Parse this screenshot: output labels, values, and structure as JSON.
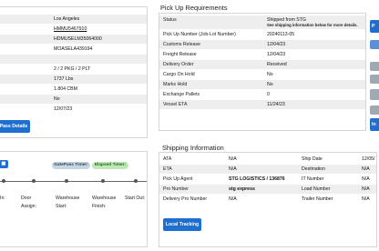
{
  "left_panel": {
    "values": [
      "Los Angeles",
      "HMMU5467910",
      "HDMUSELM35064000",
      "MOASELA439194",
      "",
      "2 / 2 PKG / 2 PLT",
      "1737 Lbs",
      "1.804 CBM",
      "No",
      "12/07/23"
    ],
    "gatepass_button": "Pass Details"
  },
  "timers": {
    "gatepass_label": "GatePass Timer:",
    "elapsed_label": "Elapsed Timer:",
    "steps": [
      {
        "line1": "In:",
        "line2": ""
      },
      {
        "line1": "Door",
        "line2": "Assign:"
      },
      {
        "line1": "Warehouse",
        "line2": "Start:"
      },
      {
        "line1": "Warehouse",
        "line2": "Finish:"
      },
      {
        "line1": "Start Out:",
        "line2": ""
      }
    ]
  },
  "pickup": {
    "title": "Pick Up Requirements",
    "rows": [
      {
        "label": "Status",
        "value": "Shipped from STG",
        "note": "See shipping information below for more details."
      },
      {
        "label": "Pick Up Number (Job-Lot Number)",
        "value": "20240113-05"
      },
      {
        "label": "Customs Release",
        "value": "12/04/23"
      },
      {
        "label": "Freight Release",
        "value": "12/04/23"
      },
      {
        "label": "Delivery Order",
        "value": "Received"
      },
      {
        "label": "Cargo On Hold",
        "value": "No"
      },
      {
        "label": "Marks Hold",
        "value": "No"
      },
      {
        "label": "Exchange Pallets",
        "value": "0"
      },
      {
        "label": "Vessel ETA",
        "value": "11/24/23"
      }
    ]
  },
  "shipping": {
    "title": "Shipping Information",
    "left_rows": [
      {
        "label": "ATA",
        "value": "N/A"
      },
      {
        "label": "ETA",
        "value": "N/A"
      },
      {
        "label": "Pick Up Agent",
        "value": "STG LOGISTICS / 136876"
      },
      {
        "label": "Pro Number",
        "value": "stg express"
      },
      {
        "label": "Delivery Pro Number",
        "value": "N/A"
      }
    ],
    "right_rows": [
      {
        "label": "Ship Date",
        "value": "12/05/"
      },
      {
        "label": "Destination",
        "value": "N/A"
      },
      {
        "label": "IT Number",
        "value": "N/A"
      },
      {
        "label": "Load Number",
        "value": "N/A"
      },
      {
        "label": "Trailer Number",
        "value": "N/A"
      }
    ],
    "tracking_button": "Local Tracking"
  },
  "side_buttons": [
    "P",
    "",
    "",
    "",
    "",
    "",
    "In"
  ],
  "colors": {
    "accent": "#1f6fd1",
    "link": "#1a3fc7",
    "stripe": "#eeeeee",
    "elapsed_pill": "#bfe8b6",
    "gatepass_pill": "#c8d4de"
  }
}
